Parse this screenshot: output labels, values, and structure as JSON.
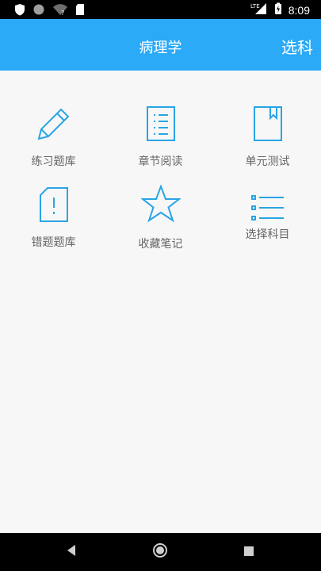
{
  "status_bar": {
    "time": "8:09",
    "network_label": "LTE",
    "icons": [
      "shield-icon",
      "circle-icon",
      "wifi-question-icon",
      "sim-card-icon",
      "signal-icon",
      "battery-charging-icon"
    ]
  },
  "header": {
    "title": "病理学",
    "action_label": "选科"
  },
  "grid": {
    "items": [
      {
        "label": "练习题库",
        "icon": "pencil-icon"
      },
      {
        "label": "章节阅读",
        "icon": "document-list-icon"
      },
      {
        "label": "单元测试",
        "icon": "bookmark-book-icon"
      },
      {
        "label": "错题题库",
        "icon": "alert-document-icon"
      },
      {
        "label": "收藏笔记",
        "icon": "star-icon"
      },
      {
        "label": "选择科目",
        "icon": "list-icon"
      }
    ]
  },
  "nav_bar": {
    "icons": [
      "back-icon",
      "home-icon",
      "recents-icon"
    ]
  },
  "colors": {
    "accent": "#2aaaf7",
    "icon_stroke": "#2aa4e6",
    "label": "#666666",
    "background": "#f7f7f7"
  }
}
